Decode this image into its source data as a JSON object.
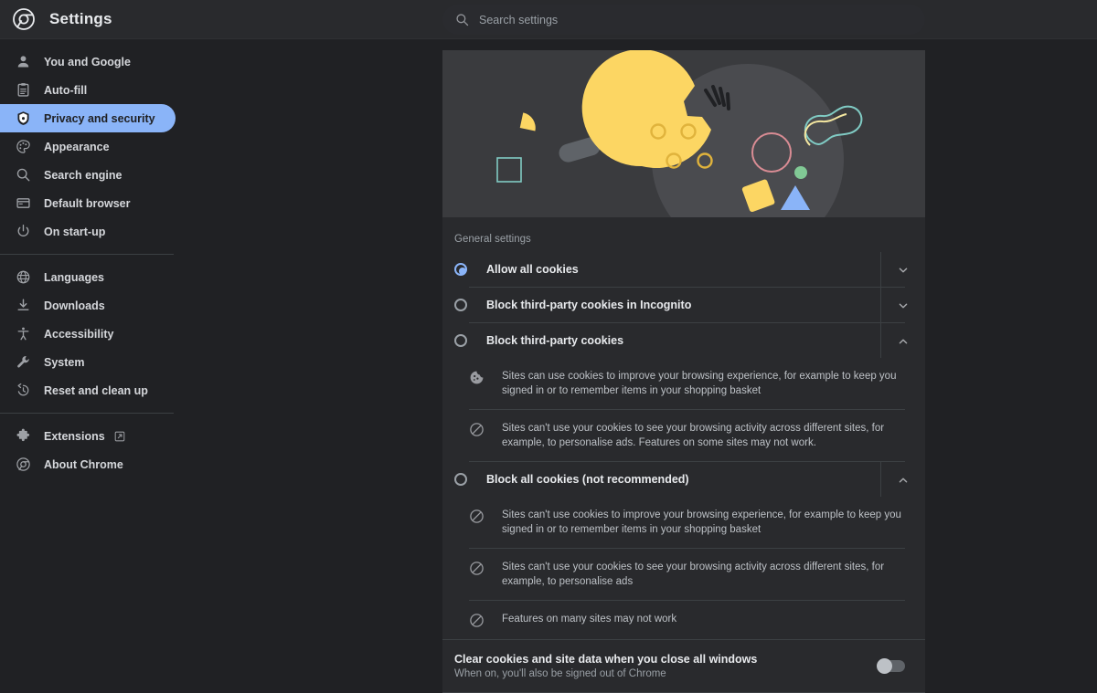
{
  "header": {
    "title": "Settings",
    "logo_icon": "chrome-logo-icon",
    "search": {
      "placeholder": "Search settings",
      "value": "",
      "icon": "search-icon"
    }
  },
  "sidebar": {
    "groups": [
      {
        "items": [
          {
            "label": "You and Google",
            "icon": "person-icon",
            "active": false
          },
          {
            "label": "Auto-fill",
            "icon": "clipboard-icon",
            "active": false
          },
          {
            "label": "Privacy and security",
            "icon": "shield-icon",
            "active": true
          },
          {
            "label": "Appearance",
            "icon": "palette-icon",
            "active": false
          },
          {
            "label": "Search engine",
            "icon": "search-icon",
            "active": false
          },
          {
            "label": "Default browser",
            "icon": "window-icon",
            "active": false
          },
          {
            "label": "On start-up",
            "icon": "power-icon",
            "active": false
          }
        ]
      },
      {
        "items": [
          {
            "label": "Languages",
            "icon": "globe-icon",
            "active": false
          },
          {
            "label": "Downloads",
            "icon": "download-icon",
            "active": false
          },
          {
            "label": "Accessibility",
            "icon": "accessibility-icon",
            "active": false
          },
          {
            "label": "System",
            "icon": "wrench-icon",
            "active": false
          },
          {
            "label": "Reset and clean up",
            "icon": "history-restore-icon",
            "active": false
          }
        ]
      },
      {
        "items": [
          {
            "label": "Extensions",
            "icon": "puzzle-icon",
            "active": false,
            "external": true,
            "external_icon": "external-link-icon"
          },
          {
            "label": "About Chrome",
            "icon": "chrome-outline-icon",
            "active": false
          }
        ]
      }
    ]
  },
  "main": {
    "hero": {
      "illustration": "cookie-illustration",
      "colors": {
        "background": "#3a3b3e",
        "cookie": "#fcd663",
        "blob": "#5f6368",
        "triangle": "#8ab4f8",
        "dot_blue": "#8ab4f8",
        "dot_green": "#81c995",
        "circle_pink": "#d98c94",
        "outline_green": "#80cbc4",
        "outline_yellow": "#f3e6a0"
      }
    },
    "section_label": "General settings",
    "options": [
      {
        "label": "Allow all cookies",
        "selected": true,
        "expanded": false,
        "chevron": "chevron-down-icon",
        "details": []
      },
      {
        "label": "Block third-party cookies in Incognito",
        "selected": false,
        "expanded": false,
        "chevron": "chevron-down-icon",
        "details": []
      },
      {
        "label": "Block third-party cookies",
        "selected": false,
        "expanded": true,
        "chevron": "chevron-up-icon",
        "details": [
          {
            "icon": "cookie-icon",
            "text": "Sites can use cookies to improve your browsing experience, for example to keep you signed in or to remember items in your shopping basket"
          },
          {
            "icon": "block-icon",
            "text": "Sites can't use your cookies to see your browsing activity across different sites, for example, to personalise ads. Features on some sites may not work."
          }
        ]
      },
      {
        "label": "Block all cookies (not recommended)",
        "selected": false,
        "expanded": true,
        "chevron": "chevron-up-icon",
        "details": [
          {
            "icon": "block-icon",
            "text": "Sites can't use cookies to improve your browsing experience, for example to keep you signed in or to remember items in your shopping basket"
          },
          {
            "icon": "block-icon",
            "text": "Sites can't use your cookies to see your browsing activity across different sites, for example, to personalise ads"
          },
          {
            "icon": "block-icon",
            "text": "Features on many sites may not work"
          }
        ]
      }
    ],
    "clear_on_close": {
      "title": "Clear cookies and site data when you close all windows",
      "subtitle": "When on, you'll also be signed out of Chrome",
      "enabled": false
    }
  },
  "theme": {
    "page_background": "#202124",
    "card_background": "#292a2d",
    "accent": "#8ab4f8",
    "divider": "#3c4043",
    "text_primary": "#e8eaed",
    "text_secondary": "#9aa0a6"
  }
}
